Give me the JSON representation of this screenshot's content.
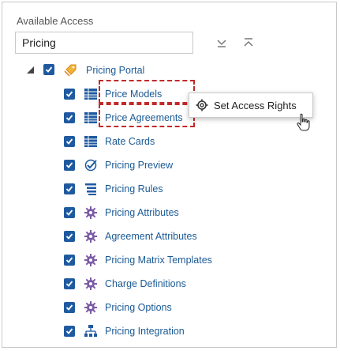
{
  "panel": {
    "heading": "Available Access",
    "search_value": "Pricing",
    "expand_all_label": "Expand All",
    "collapse_all_label": "Collapse All"
  },
  "tree": {
    "root": {
      "label": "Pricing Portal",
      "checked": true,
      "expanded": true,
      "icon": "tag-icon"
    },
    "children": [
      {
        "label": "Price Models",
        "checked": true,
        "icon": "table-icon"
      },
      {
        "label": "Price Agreements",
        "checked": true,
        "icon": "table-icon"
      },
      {
        "label": "Rate Cards",
        "checked": true,
        "icon": "table-icon"
      },
      {
        "label": "Pricing Preview",
        "checked": true,
        "icon": "check-circle-icon"
      },
      {
        "label": "Pricing Rules",
        "checked": true,
        "icon": "list-icon"
      },
      {
        "label": "Pricing Attributes",
        "checked": true,
        "icon": "gear-icon"
      },
      {
        "label": "Agreement Attributes",
        "checked": true,
        "icon": "gear-icon"
      },
      {
        "label": "Pricing Matrix Templates",
        "checked": true,
        "icon": "gear-icon"
      },
      {
        "label": "Charge Definitions",
        "checked": true,
        "icon": "gear-icon"
      },
      {
        "label": "Pricing Options",
        "checked": true,
        "icon": "gear-icon"
      },
      {
        "label": "Pricing Integration",
        "checked": true,
        "icon": "hierarchy-icon"
      }
    ]
  },
  "context_menu": {
    "item_label": "Set Access Rights",
    "icon": "gear-settings-icon"
  },
  "colors": {
    "link": "#1b5a95",
    "checkbox": "#1f5aa0",
    "highlight_dash": "#c22a2a",
    "gear": "#7b5ca4"
  }
}
